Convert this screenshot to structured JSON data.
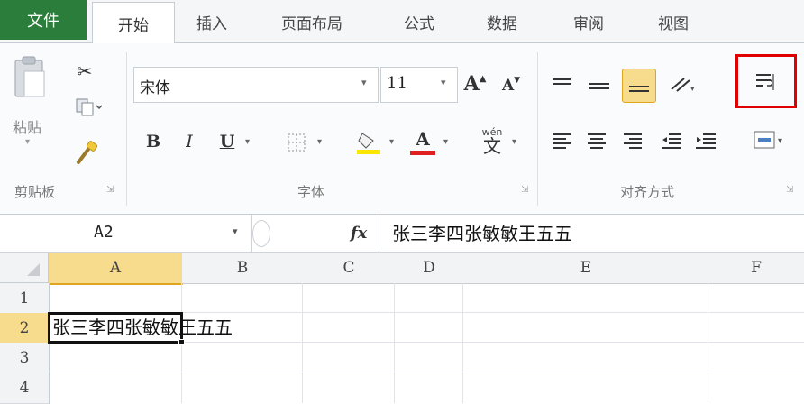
{
  "tabs": [
    "文件",
    "开始",
    "插入",
    "页面布局",
    "公式",
    "数据",
    "审阅",
    "视图"
  ],
  "clipboard": {
    "paste_label": "粘贴",
    "group_label": "剪贴板"
  },
  "font": {
    "name": "宋体",
    "size": "11",
    "group_label": "字体",
    "bold": "B",
    "italic": "I",
    "underline": "U",
    "font_color_letter": "A",
    "grow": "A",
    "shrink": "A",
    "phonetic": "wén",
    "phonetic_char": "文"
  },
  "alignment": {
    "group_label": "对齐方式"
  },
  "formula_bar": {
    "cell_ref": "A2",
    "fx": "fx",
    "content": "张三李四张敏敏王五五"
  },
  "grid": {
    "columns": [
      "A",
      "B",
      "C",
      "D",
      "E",
      "F"
    ],
    "rows": [
      "1",
      "2",
      "3",
      "4"
    ],
    "cells": {
      "A2": "张三李四张敏敏王五五"
    }
  },
  "colors": {
    "file_tab": "#2a7d3a",
    "highlight": "#f8dc8e",
    "red_box": "#e00000",
    "font_red": "#e02020",
    "fill_yellow": "#ffe600"
  },
  "icons": [
    "paste-icon",
    "cut-icon",
    "copy-icon",
    "format-painter-icon",
    "align-top-icon",
    "align-middle-icon",
    "align-bottom-icon",
    "orientation-icon",
    "wrap-text-icon",
    "align-left-icon",
    "align-center-icon",
    "align-right-icon",
    "decrease-indent-icon",
    "increase-indent-icon",
    "merge-center-icon"
  ]
}
